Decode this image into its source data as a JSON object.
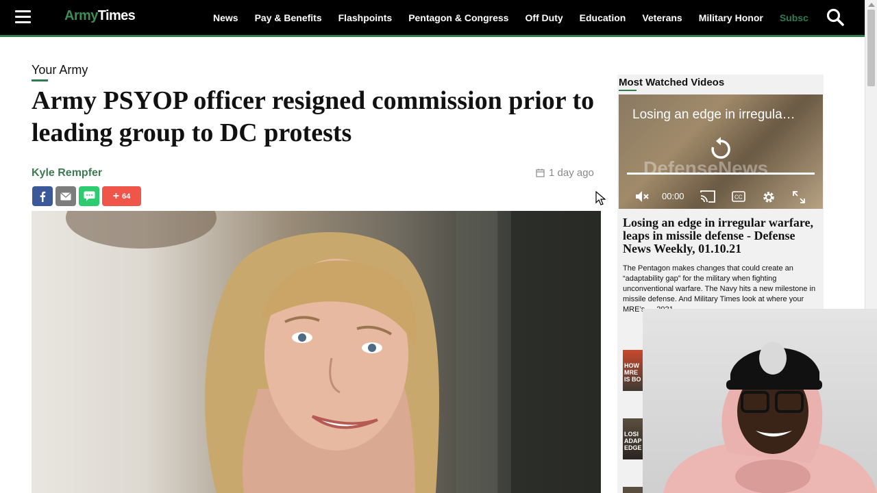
{
  "nav": {
    "logo_part1": "Army",
    "logo_part2": "Times",
    "items": [
      "News",
      "Pay & Benefits",
      "Flashpoints",
      "Pentagon & Congress",
      "Off Duty",
      "Education",
      "Veterans",
      "Military Honor"
    ],
    "subscribe": "Subsc"
  },
  "article": {
    "section": "Your Army",
    "headline": "Army PSYOP officer resigned commission prior to leading group to DC protests",
    "author": "Kyle Rempfer",
    "date": "1 day ago",
    "share_count": "64"
  },
  "sidebar": {
    "title": "Most Watched Videos",
    "video_title": "Losing an edge in irregula…",
    "video_watermark": "DefenseNews",
    "video_time": "00:00",
    "headline": "Losing an edge in irregular warfare, leaps in missile defense - Defense News Weekly, 01.10.21",
    "description": "The Pentagon makes changes that could create an “adaptability gap” for the military when fighting unconventional warfare. The Navy hits a new milestone in missile defense. And Military Times look at where your MRE’s … 2021.",
    "thumb1_text": "HOW MRE IS BO",
    "thumb2_text": "LOSI ADAP EDGE"
  },
  "colors": {
    "brand_green": "#2e7d4f",
    "facebook": "#3b5998",
    "share_more": "#f0554a"
  }
}
